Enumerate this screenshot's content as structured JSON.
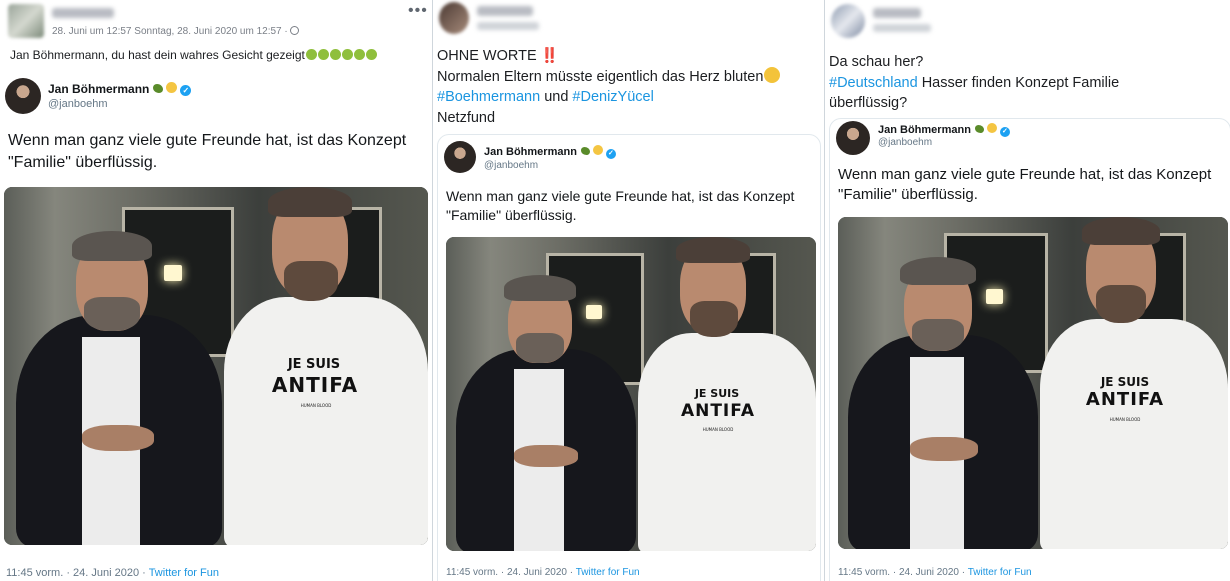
{
  "panel1": {
    "meta": "28. Juni um 12:57 Sonntag, 28. Juni 2020 um 12:57 ·",
    "menu_glyph": "•••",
    "post_text": "Jan Böhmermann, du hast dein wahres Gesicht gezeigt",
    "emoji_icon": "nauseated-face-icon",
    "emoji_count": 6,
    "tweet": {
      "name": "Jan Böhmermann",
      "handle": "@janboehm",
      "text": "Wenn man ganz viele gute Freunde hat, ist das Konzept \"Familie\" überflüssig.",
      "footer_time": "11:45 vorm. · 24. Juni 2020 · ",
      "footer_source": "Twitter for Fun"
    }
  },
  "panel2": {
    "line1": "OHNE WORTE",
    "bangbang": "‼️",
    "line2": "Normalen Eltern müsste eigentlich das Herz bluten",
    "weary_icon": "weary-face-icon",
    "hashtag1": "#Boehmermann",
    "line3_mid": " und ",
    "hashtag2": "#DenizYücel",
    "line4": "Netzfund",
    "tweet": {
      "name": "Jan Böhmermann",
      "handle": "@janboehm",
      "text": "Wenn man ganz viele gute Freunde hat, ist das Konzept \"Familie\" überflüssig.",
      "footer_time": "11:45 vorm. · 24. Juni 2020 · ",
      "footer_source": "Twitter for Fun"
    }
  },
  "panel3": {
    "line1": "Da schau her?",
    "hashtag": "#Deutschland",
    "line2_rest": " Hasser finden Konzept Familie",
    "line3": "überflüssig?",
    "tweet": {
      "name": "Jan Böhmermann",
      "handle": "@janboehm",
      "text": "Wenn man ganz viele gute Freunde hat, ist das Konzept \"Familie\" überflüssig.",
      "footer_time": "11:45 vorm. · 24. Juni 2020 · ",
      "footer_source": "Twitter for Fun"
    }
  },
  "shirt": {
    "line1": "JE SUIS",
    "line2": "ANTIFA",
    "line3": "HUMAN BLOOD"
  },
  "colors": {
    "hashtag": "#1b95e0",
    "verified": "#1da1f2",
    "bangbang": "#e0245e"
  }
}
